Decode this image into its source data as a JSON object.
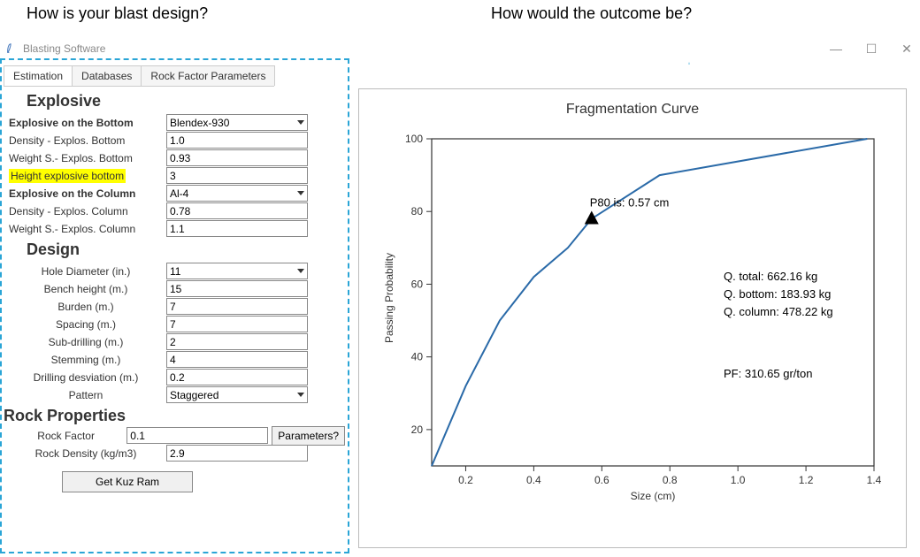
{
  "annotations": {
    "q1": "How is your blast design?",
    "q2": "How would the outcome be?"
  },
  "window": {
    "title": "Blasting Software"
  },
  "tabs": [
    "Estimation",
    "Databases",
    "Rock Factor Parameters"
  ],
  "active_tab": 0,
  "sections": {
    "explosive_title": "Explosive",
    "design_title": "Design",
    "rock_title": "Rock Properties"
  },
  "fields": {
    "explosive_bottom_label": "Explosive on the Bottom",
    "explosive_bottom_value": "Blendex-930",
    "density_bottom_label": "Density - Explos. Bottom",
    "density_bottom_value": "1.0",
    "weight_bottom_label": "Weight S.- Explos. Bottom",
    "weight_bottom_value": "0.93",
    "height_bottom_label": "Height explosive bottom",
    "height_bottom_value": "3",
    "explosive_column_label": "Explosive on the Column",
    "explosive_column_value": "Al-4",
    "density_column_label": "Density - Explos. Column",
    "density_column_value": "0.78",
    "weight_column_label": "Weight S.- Explos. Column",
    "weight_column_value": "1.1",
    "hole_diameter_label": "Hole Diameter (in.)",
    "hole_diameter_value": "11",
    "bench_height_label": "Bench height (m.)",
    "bench_height_value": "15",
    "burden_label": "Burden (m.)",
    "burden_value": "7",
    "spacing_label": "Spacing (m.)",
    "spacing_value": "7",
    "subdrilling_label": "Sub-drilling (m.)",
    "subdrilling_value": "2",
    "stemming_label": "Stemming (m.)",
    "stemming_value": "4",
    "deviation_label": "Drilling desviation (m.)",
    "deviation_value": "0.2",
    "pattern_label": "Pattern",
    "pattern_value": "Staggered",
    "rock_factor_label": "Rock Factor",
    "rock_factor_value": "0.1",
    "rock_density_label": "Rock Density (kg/m3)",
    "rock_density_value": "2.9"
  },
  "buttons": {
    "parameters": "Parameters?",
    "get_kuz_ram": "Get Kuz Ram"
  },
  "chart": {
    "title": "Fragmentation Curve",
    "xlabel": "Size (cm)",
    "ylabel": "Passing Probability",
    "p80_label": "P80 is: 0.57 cm",
    "q_total": "Q. total: 662.16 kg",
    "q_bottom": "Q. bottom: 183.93 kg",
    "q_column": "Q. column: 478.22 kg",
    "pf": "PF: 310.65 gr/ton"
  },
  "chart_data": {
    "type": "line",
    "title": "Fragmentation Curve",
    "xlabel": "Size (cm)",
    "ylabel": "Passing Probability",
    "xlim": [
      0.1,
      1.4
    ],
    "ylim": [
      10,
      100
    ],
    "xticks": [
      0.2,
      0.4,
      0.6,
      0.8,
      1.0,
      1.2,
      1.4
    ],
    "yticks": [
      20,
      40,
      60,
      80,
      100
    ],
    "x": [
      0.1,
      0.2,
      0.3,
      0.4,
      0.5,
      0.57,
      0.77,
      1.38
    ],
    "y": [
      10,
      32,
      50,
      62,
      70,
      78,
      90,
      100
    ],
    "marker": {
      "x": 0.57,
      "y": 78,
      "label": "P80 is: 0.57 cm"
    },
    "annotations": [
      {
        "text": "Q. total: 662.16 kg"
      },
      {
        "text": "Q. bottom: 183.93 kg"
      },
      {
        "text": "Q. column: 478.22 kg"
      },
      {
        "text": "PF: 310.65 gr/ton"
      }
    ]
  }
}
